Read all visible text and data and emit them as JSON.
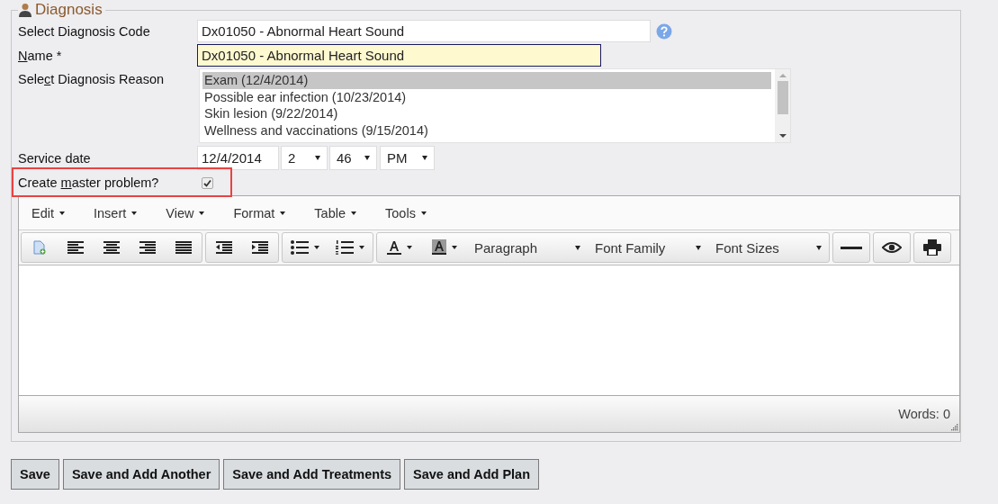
{
  "section": {
    "legend": "Diagnosis"
  },
  "code_field": {
    "label": "Select Diagnosis Code",
    "value": "Dx01050 - Abnormal Heart Sound"
  },
  "name_field": {
    "access_key": "N",
    "label_after": "ame *",
    "value": "Dx01050 - Abnormal Heart Sound"
  },
  "reason_field": {
    "label_before": "Sele",
    "access_key": "c",
    "label_after": "t Diagnosis Reason",
    "options": [
      {
        "text": "Exam (12/4/2014)",
        "selected": true
      },
      {
        "text": "Possible ear infection (10/23/2014)",
        "selected": false
      },
      {
        "text": "Skin lesion (9/22/2014)",
        "selected": false
      },
      {
        "text": "Wellness and vaccinations (9/15/2014)",
        "selected": false
      }
    ]
  },
  "service_date": {
    "label": "Service date",
    "date": "12/4/2014",
    "hour": "2",
    "minute": "46",
    "ampm": "PM"
  },
  "master_problem": {
    "label_before": "Create ",
    "access_key": "m",
    "label_after": "aster problem?",
    "checked": true,
    "highlighted": true
  },
  "editor": {
    "menus": [
      "Edit",
      "Insert",
      "View",
      "Format",
      "Table",
      "Tools"
    ],
    "dropdowns": [
      "Paragraph",
      "Font Family",
      "Font Sizes"
    ],
    "status": "Words: 0"
  },
  "buttons": [
    "Save",
    "Save and Add Another",
    "Save and Add Treatments",
    "Save and Add Plan"
  ]
}
